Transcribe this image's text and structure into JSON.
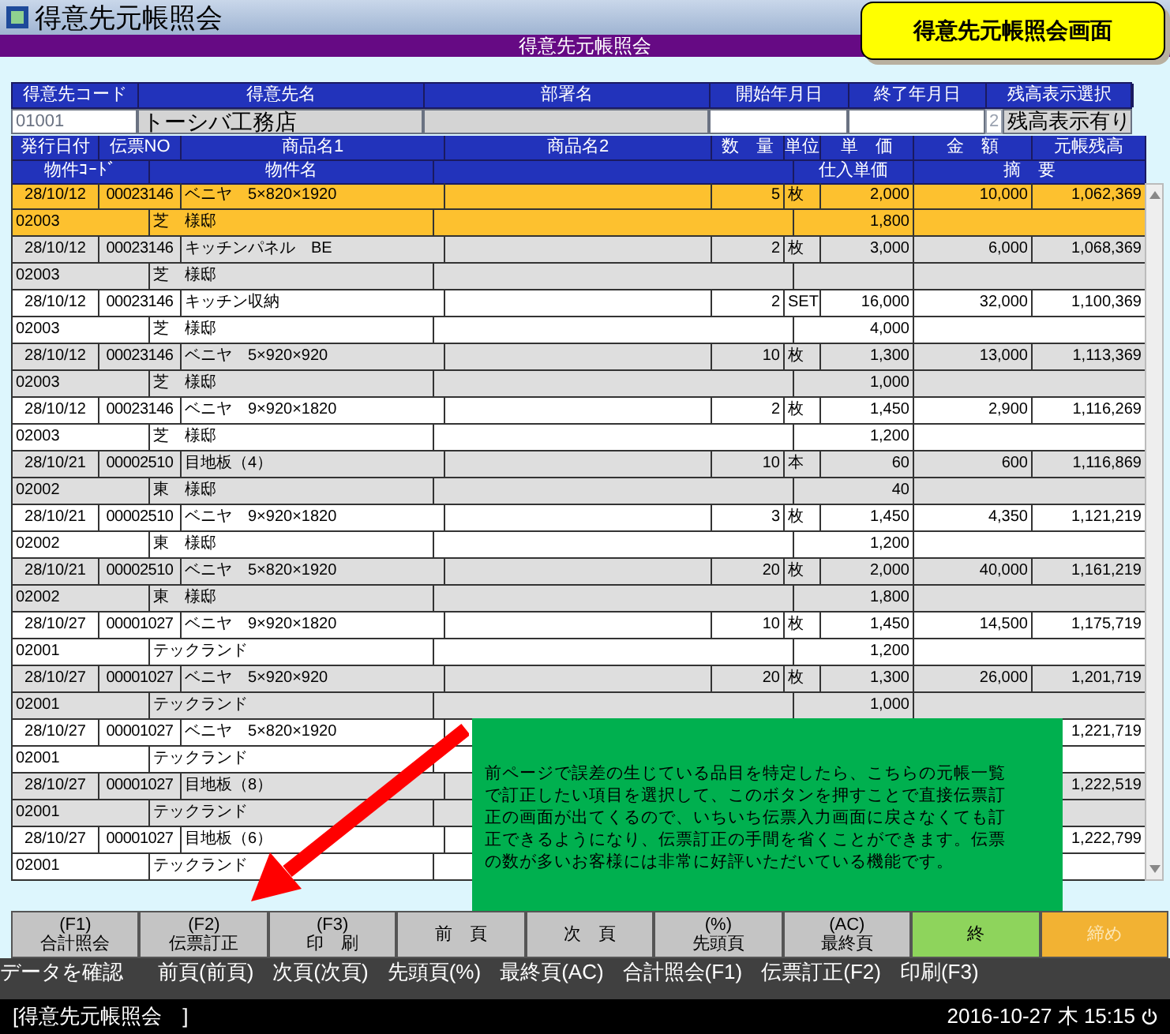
{
  "window": {
    "title": "得意先元帳照会",
    "subtitle": "得意先元帳照会"
  },
  "badge": "得意先元帳照会画面",
  "customer": {
    "labels": [
      "得意先コード",
      "得意先名",
      "部署名",
      "開始年月日",
      "終了年月日",
      "残高表示選択"
    ],
    "code": "01001",
    "name": "トーシバ工務店",
    "option_value": "2",
    "option_label": "残高表示有り"
  },
  "table": {
    "columns": [
      "発行日付",
      "伝票NO",
      "商品名1",
      "商品名2",
      "数　量",
      "単位",
      "単　価",
      "金　額",
      "元帳残高"
    ],
    "sub_columns": [
      "物件ｺｰﾄﾞ",
      "物件名",
      "",
      "仕入単価",
      "摘　要"
    ],
    "rows": [
      {
        "selected": true,
        "date": "28/10/12",
        "slip": "00023146",
        "item": "ベニヤ　5×820×1920",
        "qty": "5",
        "unit": "枚",
        "price": "2,000",
        "amount": "10,000",
        "balance": "1,062,369",
        "site_code": "02003",
        "site": "芝　様邸",
        "cost": "1,800"
      },
      {
        "selected": false,
        "date": "28/10/12",
        "slip": "00023146",
        "item": "キッチンパネル　BE",
        "qty": "2",
        "unit": "枚",
        "price": "3,000",
        "amount": "6,000",
        "balance": "1,068,369",
        "site_code": "02003",
        "site": "芝　様邸"
      },
      {
        "selected": false,
        "date": "28/10/12",
        "slip": "00023146",
        "item": "キッチン収納",
        "qty": "2",
        "unit": "SET",
        "price": "16,000",
        "amount": "32,000",
        "balance": "1,100,369",
        "site_code": "02003",
        "site": "芝　様邸",
        "cost": "4,000"
      },
      {
        "selected": false,
        "date": "28/10/12",
        "slip": "00023146",
        "item": "ベニヤ　5×920×920",
        "qty": "10",
        "unit": "枚",
        "price": "1,300",
        "amount": "13,000",
        "balance": "1,113,369",
        "site_code": "02003",
        "site": "芝　様邸",
        "cost": "1,000"
      },
      {
        "selected": false,
        "date": "28/10/12",
        "slip": "00023146",
        "item": "ベニヤ　9×920×1820",
        "qty": "2",
        "unit": "枚",
        "price": "1,450",
        "amount": "2,900",
        "balance": "1,116,269",
        "site_code": "02003",
        "site": "芝　様邸",
        "cost": "1,200"
      },
      {
        "selected": false,
        "date": "28/10/21",
        "slip": "00002510",
        "item": "目地板（4）",
        "qty": "10",
        "unit": "本",
        "price": "60",
        "amount": "600",
        "balance": "1,116,869",
        "site_code": "02002",
        "site": "東　様邸",
        "cost": "40"
      },
      {
        "selected": false,
        "date": "28/10/21",
        "slip": "00002510",
        "item": "ベニヤ　9×920×1820",
        "qty": "3",
        "unit": "枚",
        "price": "1,450",
        "amount": "4,350",
        "balance": "1,121,219",
        "site_code": "02002",
        "site": "東　様邸",
        "cost": "1,200"
      },
      {
        "selected": false,
        "date": "28/10/21",
        "slip": "00002510",
        "item": "ベニヤ　5×820×1920",
        "qty": "20",
        "unit": "枚",
        "price": "2,000",
        "amount": "40,000",
        "balance": "1,161,219",
        "site_code": "02002",
        "site": "東　様邸",
        "cost": "1,800"
      },
      {
        "selected": false,
        "date": "28/10/27",
        "slip": "00001027",
        "item": "ベニヤ　9×920×1820",
        "qty": "10",
        "unit": "枚",
        "price": "1,450",
        "amount": "14,500",
        "balance": "1,175,719",
        "site_code": "02001",
        "site": "テックランド",
        "cost": "1,200"
      },
      {
        "selected": false,
        "date": "28/10/27",
        "slip": "00001027",
        "item": "ベニヤ　5×920×920",
        "qty": "20",
        "unit": "枚",
        "price": "1,300",
        "amount": "26,000",
        "balance": "1,201,719",
        "site_code": "02001",
        "site": "テックランド",
        "cost": "1,000"
      },
      {
        "selected": false,
        "date": "28/10/27",
        "slip": "00001027",
        "item": "ベニヤ　5×820×1920",
        "balance": "1,221,719",
        "site_code": "02001",
        "site": "テックランド"
      },
      {
        "selected": false,
        "date": "28/10/27",
        "slip": "00001027",
        "item": "目地板（8）",
        "balance": "1,222,519",
        "site_code": "02001",
        "site": "テックランド"
      },
      {
        "selected": false,
        "date": "28/10/27",
        "slip": "00001027",
        "item": "目地板（6）",
        "balance": "1,222,799",
        "site_code": "02001",
        "site": "テックランド"
      }
    ]
  },
  "callout": "前ページで誤差の生じている品目を特定したら、こちらの元帳一覧で訂正したい項目を選択して、このボタンを押すことで直接伝票訂正の画面が出てくるので、いちいち伝票入力画面に戻さなくても訂正できるようになり、伝票訂正の手間を省くことができます。伝票の数が多いお客様には非常に好評いただいている機能です。",
  "function_keys": [
    {
      "key": "(F1)",
      "label": "合計照会",
      "kind": "normal"
    },
    {
      "key": "(F2)",
      "label": "伝票訂正",
      "kind": "normal"
    },
    {
      "key": "(F3)",
      "label": "印　刷",
      "kind": "normal"
    },
    {
      "label": "前　頁",
      "kind": "normal"
    },
    {
      "label": "次　頁",
      "kind": "normal"
    },
    {
      "key": "(%)",
      "label": "先頭頁",
      "kind": "normal"
    },
    {
      "key": "(AC)",
      "label": "最終頁",
      "kind": "normal"
    },
    {
      "label": "終",
      "kind": "end"
    },
    {
      "label": "締め",
      "kind": "close"
    }
  ],
  "hints": [
    "データを確認",
    "前頁(前頁)",
    "次頁(次頁)",
    "先頭頁(%)",
    "最終頁(AC)",
    "合計照会(F1)",
    "伝票訂正(F2)",
    "印刷(F3)"
  ],
  "status_bar": {
    "screen": "[得意先元帳照会　]",
    "datetime": "2016-10-27 木 15:15"
  }
}
